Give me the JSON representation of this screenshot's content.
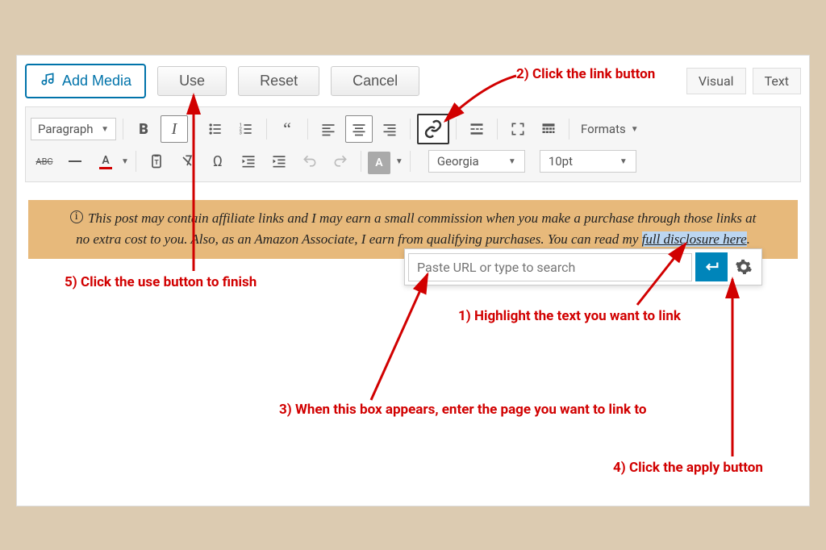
{
  "top": {
    "add_media": "Add Media",
    "use": "Use",
    "reset": "Reset",
    "cancel": "Cancel",
    "visual": "Visual",
    "text": "Text"
  },
  "toolbar": {
    "paragraph": "Paragraph",
    "formats": "Formats",
    "font_family": "Georgia",
    "font_size": "10pt"
  },
  "content": {
    "info": "i",
    "line1_a": " This post may contain affiliate links and I may earn a small commission when you make a purchase through those links at",
    "line2_a": "no extra cost to you. Also, as an Amazon Associate, I earn from qualifying purchases. You can read my ",
    "linked_text": "full disclosure here",
    "period": "."
  },
  "link_popup": {
    "placeholder": "Paste URL or type to search"
  },
  "annotations": {
    "a1": "1) Highlight the text you want to link",
    "a2": "2) Click the link button",
    "a3": "3) When this box appears, enter the page you want to link to",
    "a4": "4) Click the apply button",
    "a5": "5) Click the use button to finish"
  }
}
